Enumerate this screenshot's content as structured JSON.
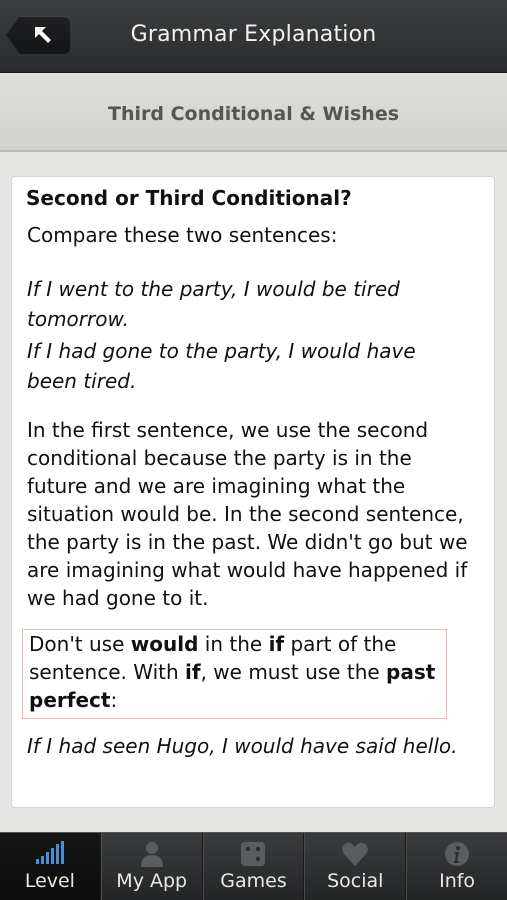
{
  "header": {
    "title": "Grammar Explanation",
    "back_icon": "back-arrow-icon"
  },
  "subheader": {
    "title": "Third Conditional & Wishes"
  },
  "content": {
    "heading": "Second or Third Conditional?",
    "intro": "Compare these two sentences:",
    "example1": "If I went to the party, I would be tired tomorrow.",
    "example2": "If I had gone to the party, I would have been tired.",
    "explanation": "In the first sentence, we use the second conditional because the party is in the future and we are imagining what the situation would be. In the second sentence, the party is in the past. We didn't go but we are imagining what would have happened if we had gone to it.",
    "note": {
      "t1": "Don't use ",
      "b1": "would",
      "t2": " in the ",
      "b2": "if",
      "t3": " part of the sentence. With ",
      "b3": "if",
      "t4": ", we must use the ",
      "b4": "past perfect",
      "t5": ":"
    },
    "example3": "If I had seen Hugo, I would have said hello."
  },
  "tabs": [
    {
      "label": "Level",
      "icon": "level-bars-icon",
      "active": true
    },
    {
      "label": "My App",
      "icon": "person-icon",
      "active": false
    },
    {
      "label": "Games",
      "icon": "dice-icon",
      "active": false
    },
    {
      "label": "Social",
      "icon": "heart-icon",
      "active": false
    },
    {
      "label": "Info",
      "icon": "info-icon",
      "active": false
    }
  ],
  "colors": {
    "header_bg": "#2f3133",
    "note_border": "#f0b8b0",
    "level_icon_blue": "#4a8fd6"
  }
}
